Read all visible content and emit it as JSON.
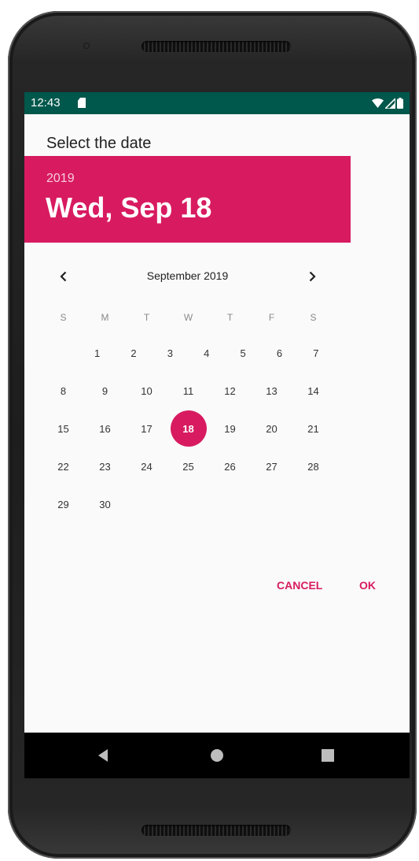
{
  "status_bar": {
    "time": "12:43",
    "icons": [
      "sd-card-icon",
      "wifi-icon",
      "signal-icon",
      "battery-icon"
    ]
  },
  "dialog": {
    "title": "Select the date",
    "header": {
      "year": "2019",
      "date": "Wed, Sep 18"
    },
    "calendar": {
      "month_label": "September 2019",
      "weekdays": [
        "S",
        "M",
        "T",
        "W",
        "T",
        "F",
        "S"
      ],
      "weeks": [
        [
          "",
          "1",
          "2",
          "3",
          "4",
          "5",
          "6",
          "7"
        ],
        [
          "8",
          "9",
          "10",
          "11",
          "12",
          "13",
          "14"
        ],
        [
          "15",
          "16",
          "17",
          "18",
          "19",
          "20",
          "21"
        ],
        [
          "22",
          "23",
          "24",
          "25",
          "26",
          "27",
          "28"
        ],
        [
          "29",
          "30",
          "",
          "",
          "",
          "",
          ""
        ]
      ],
      "selected_day": "18"
    },
    "actions": {
      "cancel_label": "CANCEL",
      "ok_label": "OK"
    }
  },
  "colors": {
    "accent": "#d81b60",
    "status_bar": "#00574b",
    "dialog_background": "#fafafa"
  },
  "navigation_bar": {
    "icons": [
      "back-icon",
      "home-icon",
      "recents-icon"
    ]
  }
}
